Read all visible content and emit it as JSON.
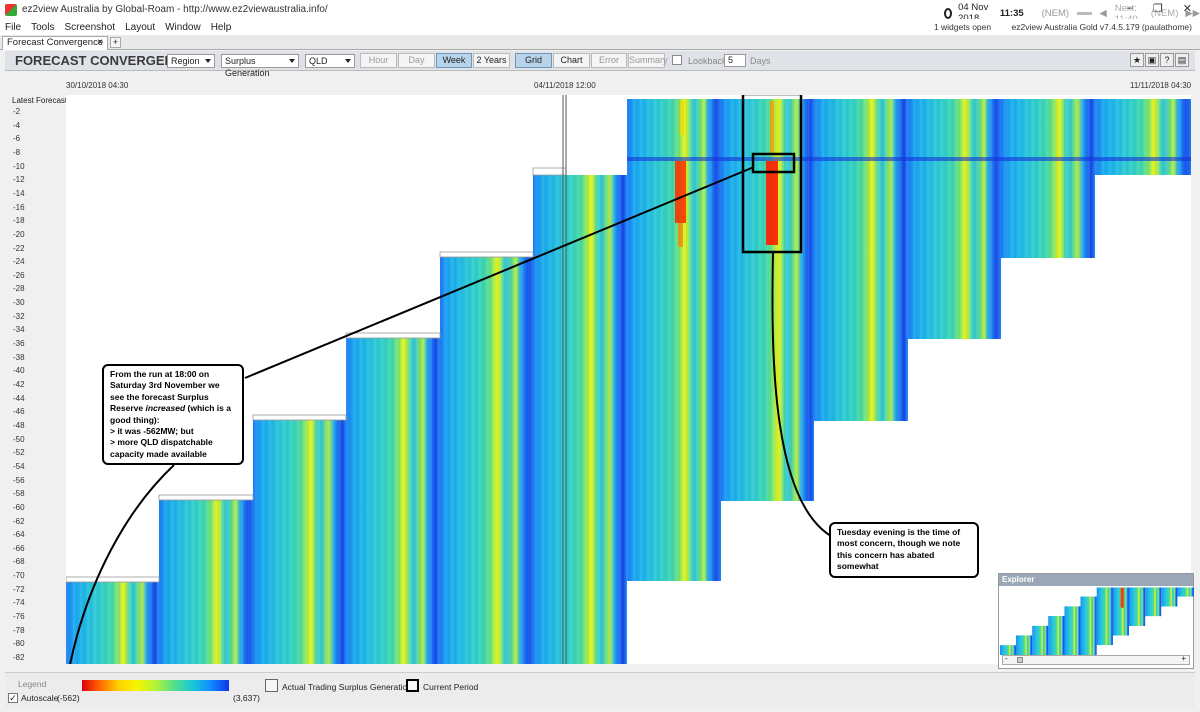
{
  "window": {
    "title": "ez2view Australia by Global-Roam - http://www.ez2viewaustralia.info/",
    "date": "04 Nov 2018",
    "time": "11:35",
    "region_code": "(NEM)",
    "next_label": "Next: 11:40",
    "next_region": "(NEM)",
    "minimize_icon": "minimize-icon",
    "maximize_icon": "restore-icon",
    "close_icon": "close-icon"
  },
  "menu": {
    "items": [
      "File",
      "Tools",
      "Screenshot",
      "Layout",
      "Window",
      "Help"
    ],
    "widgets_open": "1 widgets open",
    "version": "ez2view Australia Gold v7.4.5.179 (paulathome)"
  },
  "tabs": [
    {
      "label": "Forecast Convergence",
      "close": "×"
    }
  ],
  "tab_add": "+",
  "widget": {
    "title": "FORECAST CONVERGENCE",
    "dropdowns": {
      "mode": "Region",
      "measure": "Surplus Generation",
      "region": "QLD"
    },
    "range_buttons": [
      "Hour",
      "Day",
      "Week",
      "2 Years"
    ],
    "view_buttons": [
      "Grid",
      "Chart",
      "Error",
      "Summary"
    ],
    "active_range": "Week",
    "active_view": "Grid",
    "lookback_label": "Lookback",
    "lookback_value": "5",
    "days_label": "Days",
    "header_icons": [
      "star-icon",
      "camera-icon",
      "help-icon",
      "comment-icon"
    ],
    "header_icon_glyphs": [
      "★",
      "▣",
      "?",
      "▤"
    ]
  },
  "axis": {
    "top_labels": [
      "30/10/2018 04:30",
      "04/11/2018 12:00",
      "11/11/2018 04:30"
    ],
    "left_title": "Latest Forecast",
    "y_ticks": [
      "-2",
      "-4",
      "-6",
      "-8",
      "-10",
      "-12",
      "-14",
      "-16",
      "-18",
      "-20",
      "-22",
      "-24",
      "-26",
      "-28",
      "-30",
      "-32",
      "-34",
      "-36",
      "-38",
      "-40",
      "-42",
      "-44",
      "-46",
      "-48",
      "-50",
      "-52",
      "-54",
      "-56",
      "-58",
      "-60",
      "-62",
      "-64",
      "-66",
      "-68",
      "-70",
      "-72",
      "-74",
      "-76",
      "-78",
      "-80",
      "-82"
    ]
  },
  "callouts": {
    "left": {
      "line1": "From the run at 18:00 on",
      "line2": "Saturday 3rd November we",
      "line3": "see the forecast Surplus",
      "line4_a": "Reserve ",
      "line4_em": "increased",
      "line4_b": " (which is a",
      "line5": "good thing):",
      "line6": "> it was -562MW; but",
      "line7": "> more QLD dispatchable",
      "line8": "capacity made available"
    },
    "right": {
      "line1": "Tuesday evening is the time of",
      "line2": "most concern, though we note",
      "line3": "this concern has abated",
      "line4": "somewhat"
    }
  },
  "explorer": {
    "title": "Explorer",
    "minus": "-",
    "plus": "+"
  },
  "legend": {
    "title": "Legend",
    "autoscale": "Autoscale",
    "autoscale_checked": "✓",
    "min": "(-562)",
    "max": "(3,637)",
    "actual_label": "Actual Trading Surplus Generation",
    "current_label": "Current Period"
  },
  "colors": {
    "low": "#e0000d",
    "mid": "#f4f600",
    "high": "#0e35e8"
  }
}
